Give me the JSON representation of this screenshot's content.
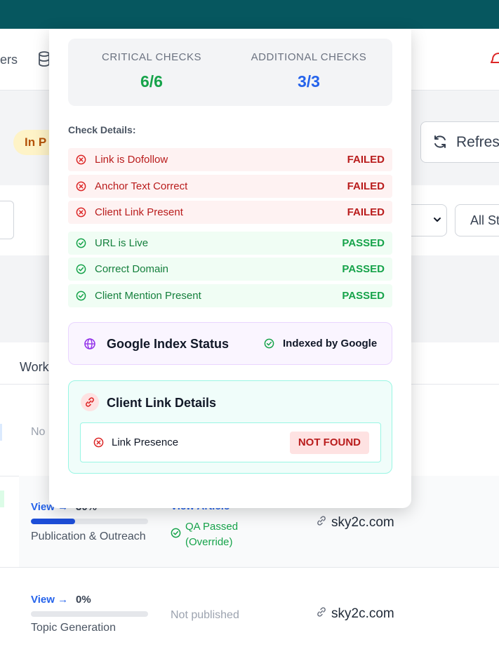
{
  "nav": {
    "partial_label": "ers"
  },
  "status_pill": {
    "label": "In P"
  },
  "refresh_button": {
    "label": "Refresh"
  },
  "filters": {
    "status_select": "All St"
  },
  "table": {
    "column_partial": "Work",
    "rows": [
      {
        "partial_text": "No"
      },
      {
        "view": "View →",
        "progress_text": "30%",
        "progress": 0.38,
        "stage": "Publication & Outreach",
        "article_link": "View Article",
        "qa": "QA Passed (Override)",
        "domain": "sky2c.com"
      },
      {
        "view": "View →",
        "progress_text": "0%",
        "progress": 0,
        "stage": "Topic Generation",
        "publish_status": "Not published",
        "domain": "sky2c.com"
      }
    ]
  },
  "popover": {
    "summary": {
      "critical_label": "CRITICAL CHECKS",
      "critical_value": "6/6",
      "additional_label": "ADDITIONAL CHECKS",
      "additional_value": "3/3"
    },
    "details_title": "Check Details:",
    "checks": [
      {
        "label": "Link is Dofollow",
        "status": "FAILED"
      },
      {
        "label": "Anchor Text Correct",
        "status": "FAILED"
      },
      {
        "label": "Client Link Present",
        "status": "FAILED"
      },
      {
        "label": "URL is Live",
        "status": "PASSED"
      },
      {
        "label": "Correct Domain",
        "status": "PASSED"
      },
      {
        "label": "Client Mention Present",
        "status": "PASSED"
      }
    ],
    "google_index": {
      "title": "Google Index Status",
      "status": "Indexed by Google"
    },
    "client_link": {
      "title": "Client Link Details",
      "presence_label": "Link Presence",
      "presence_status": "NOT FOUND"
    }
  },
  "colors": {
    "topbar": "#06575f",
    "critical": "#16a34a",
    "additional": "#2563eb",
    "failed": "#b91c1c",
    "passed": "#16a34a"
  }
}
